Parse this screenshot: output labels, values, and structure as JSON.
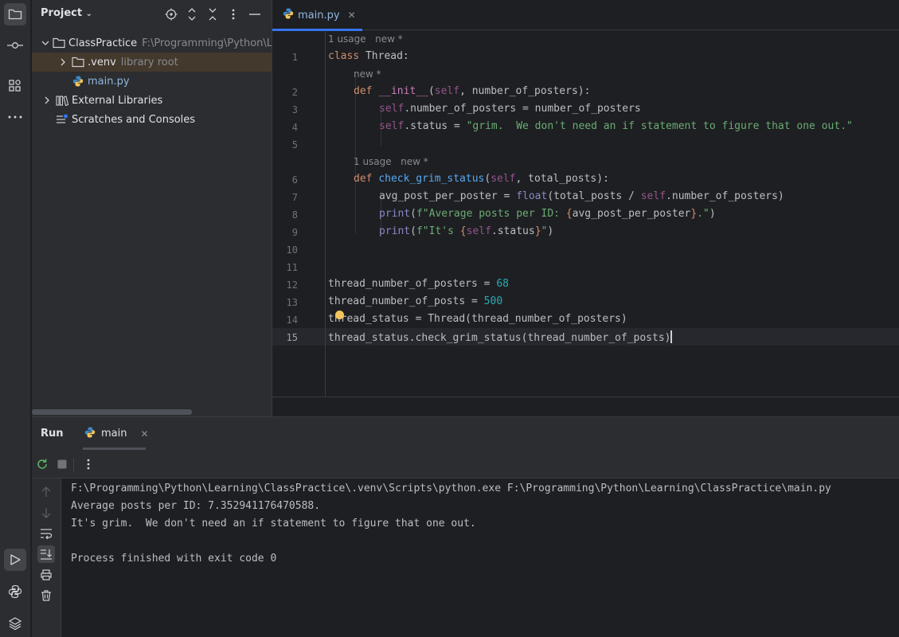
{
  "project": {
    "title": "Project",
    "tree": [
      {
        "label": "ClassPractice",
        "hint": "F:\\Programming\\Python\\Learning\\ClassPractice"
      },
      {
        "label": ".venv",
        "hint": "library root"
      },
      {
        "label": "main.py",
        "hint": ""
      },
      {
        "label": "External Libraries",
        "hint": ""
      },
      {
        "label": "Scratches and Consoles",
        "hint": ""
      }
    ]
  },
  "editor": {
    "tab_label": "main.py",
    "inlay": {
      "usage_1": "1 usage",
      "new": "new *"
    },
    "line_numbers": [
      "1",
      "2",
      "3",
      "4",
      "5",
      "6",
      "7",
      "8",
      "9",
      "10",
      "11",
      "12",
      "13",
      "14",
      "15"
    ],
    "code": {
      "l1_kw": "class",
      "l1_name": " Thread:",
      "l2_def": "def",
      "l2_fn": "__init__",
      "l2_open": "(",
      "l2_self": "self",
      "l2_rest": ", number_of_posters):",
      "l3_self": "self",
      "l3_rest": ".number_of_posters = number_of_posters",
      "l4_self": "self",
      "l4_mid": ".status = ",
      "l4_str": "\"grim.  We don't need an if statement to figure that one out.\"",
      "l6_def": "def",
      "l6_fn": "check_grim_status",
      "l6_open": "(",
      "l6_self": "self",
      "l6_rest": ", total_posts):",
      "l7_a": "avg_post_per_poster = ",
      "l7_float": "float",
      "l7_b": "(total_posts / ",
      "l7_self": "self",
      "l7_c": ".number_of_posters)",
      "l8_print": "print",
      "l8_open": "(",
      "l8_f": "f\"Average posts per ID: ",
      "l8_brace_o": "{",
      "l8_var": "avg_post_per_poster",
      "l8_brace_c": "}",
      "l8_end_str": ".\"",
      "l8_close": ")",
      "l9_print": "print",
      "l9_open": "(",
      "l9_f": "f\"It's ",
      "l9_brace_o": "{",
      "l9_self": "self",
      "l9_attr": ".status",
      "l9_brace_c": "}",
      "l9_end_str": "\"",
      "l9_close": ")",
      "l12_a": "thread_number_of_posters = ",
      "l12_num": "68",
      "l13_a": "thread_number_of_posts = ",
      "l13_num": "500",
      "l14": "thread_status = Thread(thread_number_of_posters)",
      "l15_a": "thread_status.check_grim_status",
      "l15_b": "(thread_number_of_posts)"
    }
  },
  "run": {
    "title": "Run",
    "tab_label": "main",
    "output": [
      "F:\\Programming\\Python\\Learning\\ClassPractice\\.venv\\Scripts\\python.exe F:\\Programming\\Python\\Learning\\ClassPractice\\main.py",
      "Average posts per ID: 7.352941176470588.",
      "It's grim.  We don't need an if statement to figure that one out.",
      "",
      "Process finished with exit code 0"
    ]
  },
  "colors": {
    "accent": "#3574f0",
    "keyword": "#cf8e6d",
    "function": "#56a8f5",
    "string": "#6aab73",
    "number": "#2aacb8",
    "self": "#94558d"
  }
}
